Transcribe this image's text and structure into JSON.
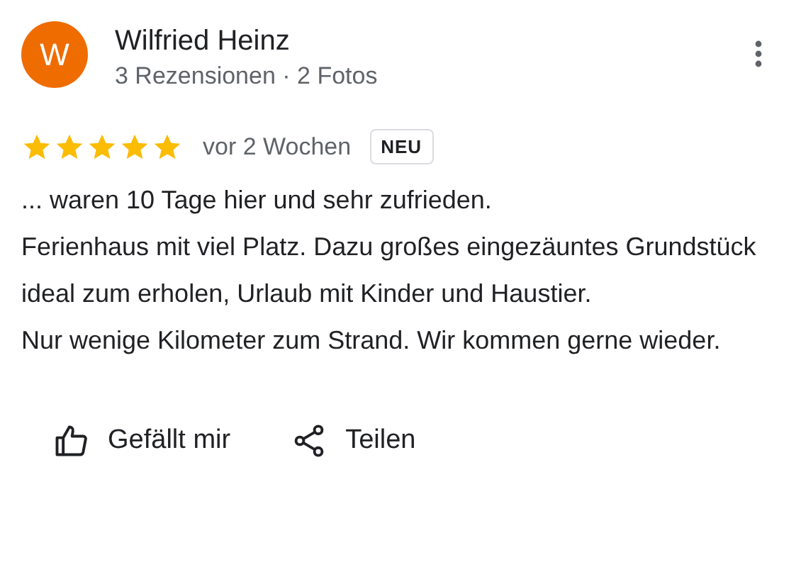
{
  "author": {
    "initial": "W",
    "color": "#ef6c00",
    "name": "Wilfried Heinz",
    "meta": "3 Rezensionen · 2 Fotos"
  },
  "review": {
    "stars": 5,
    "time": "vor 2 Wochen",
    "badge": "NEU",
    "paragraphs": [
      "... waren 10 Tage hier und sehr zufrieden.",
      "Ferienhaus mit viel Platz. Dazu großes eingezäuntes Grundstück ideal zum erholen, Urlaub mit Kinder und Haustier.",
      "Nur wenige Kilometer zum Strand. Wir kommen gerne wieder."
    ]
  },
  "actions": [
    {
      "kind": "like",
      "label": "Gefällt mir"
    },
    {
      "kind": "share",
      "label": "Teilen"
    }
  ]
}
